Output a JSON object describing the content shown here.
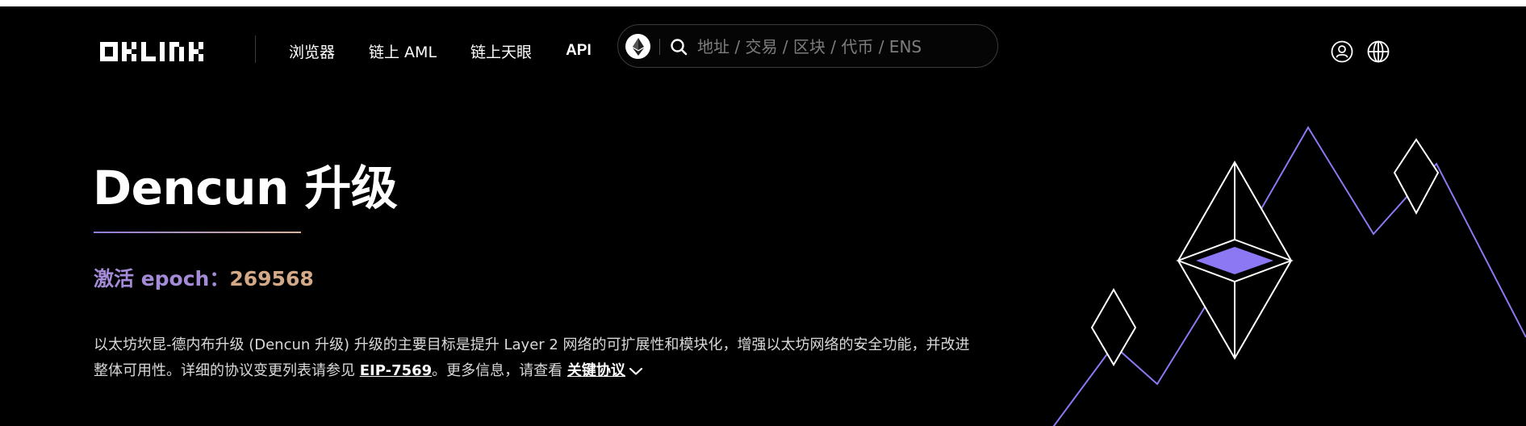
{
  "header": {
    "logo_text": "OKLINK",
    "nav": [
      {
        "label": "浏览器"
      },
      {
        "label": "链上 AML"
      },
      {
        "label": "链上天眼"
      },
      {
        "label": "API"
      }
    ],
    "search": {
      "chain_icon": "ethereum-icon",
      "placeholder": "地址 / 交易 / 区块 / 代币 / ENS"
    },
    "icons": [
      "user-icon",
      "globe-icon"
    ]
  },
  "hero": {
    "title": "Dencun 升级",
    "epoch_label": "激活 epoch：",
    "epoch_value": "269568",
    "description": {
      "part1": "以太坊坎昆-德内布升级 (Dencun 升级) 升级的主要目标是提升 Layer 2 网络的可扩展性和模块化，增强以太坊网络的安全功能，并改进整体可用性。详细的协议变更列表请参见 ",
      "link1": "EIP-7569",
      "part2": "。更多信息，请查看 ",
      "link2": "关键协议"
    }
  },
  "colors": {
    "background": "#000000",
    "accent_purple": "#8b78f2",
    "epoch_label": "#a48bd8",
    "epoch_value": "#d4a987",
    "text": "#ffffff"
  }
}
